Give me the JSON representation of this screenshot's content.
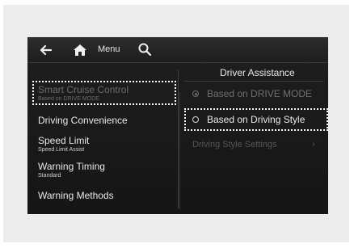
{
  "topbar": {
    "back_icon": "back-arrow-icon",
    "home_icon": "home-icon",
    "menu_label": "Menu",
    "search_icon": "search-icon"
  },
  "left_menu": {
    "items": [
      {
        "title": "Smart Cruise Control",
        "subtitle": "Based on DRIVE MODE",
        "state": "dimmed-focused"
      },
      {
        "title": "Driving Convenience",
        "subtitle": ""
      },
      {
        "title": "Speed Limit",
        "subtitle": "Speed Limit Assist"
      },
      {
        "title": "Warning Timing",
        "subtitle": "Standard"
      },
      {
        "title": "Warning Methods",
        "subtitle": ""
      }
    ]
  },
  "right_panel": {
    "title": "Driver Assistance",
    "options": [
      {
        "label": "Based on DRIVE MODE",
        "selected": true,
        "dimmed": true
      },
      {
        "label": "Based on Driving Style",
        "selected": false,
        "dimmed": false,
        "focused": true
      }
    ],
    "sub_setting": "Driving Style Settings",
    "chevron": "›"
  },
  "colors": {
    "screen_bg": "#1a1a1a",
    "text": "#e8e8e8",
    "dim_text": "#6b6b6b",
    "focus_outline": "#ffffff"
  }
}
